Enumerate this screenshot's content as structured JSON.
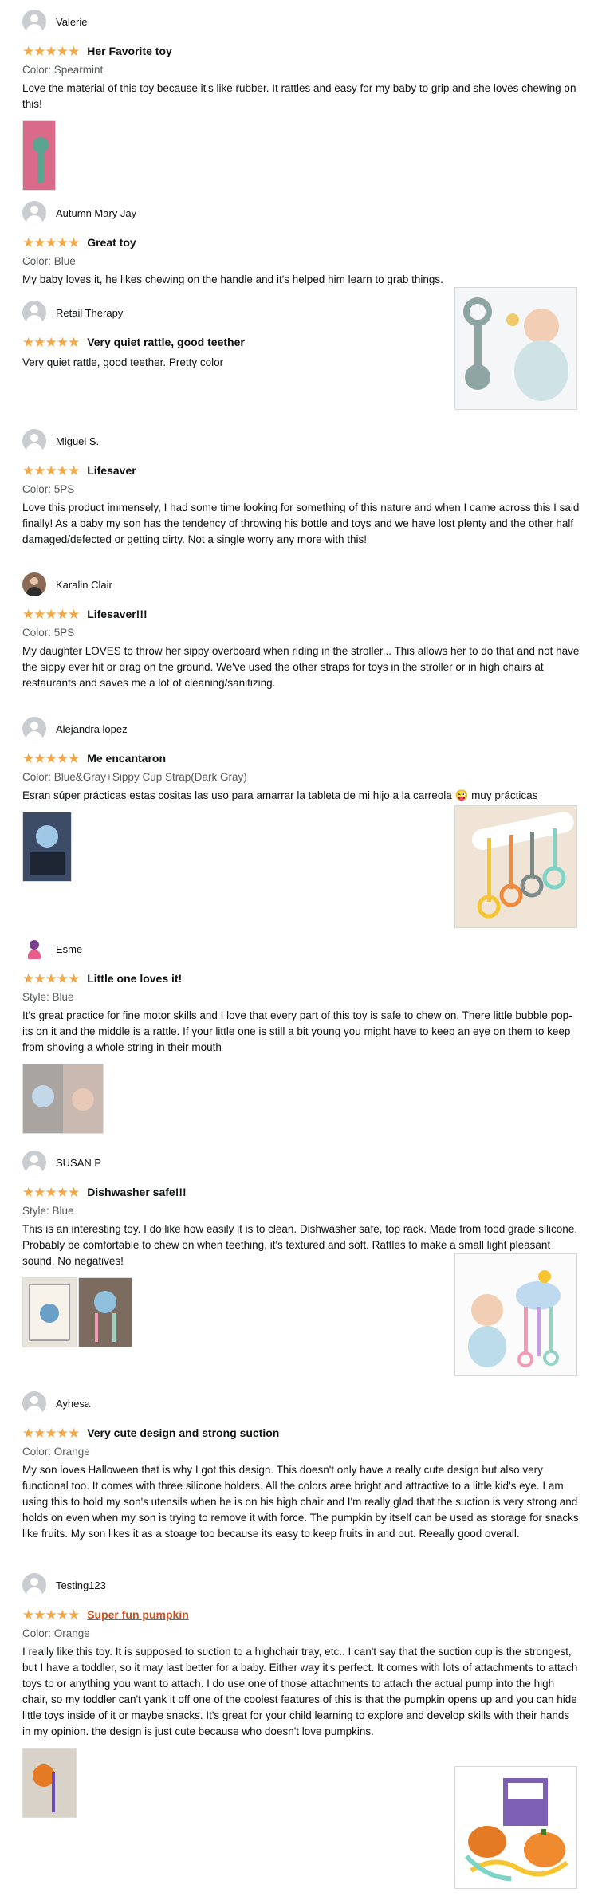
{
  "reviews": [
    {
      "name": "Valerie",
      "stars": "★★★★★",
      "title": "Her Favorite toy",
      "variant": "Color: Spearmint",
      "body": "Love the material of this toy because it's like rubber. It rattles and easy for my baby to grip and she loves chewing on this!"
    },
    {
      "name": "Autumn Mary Jay",
      "stars": "★★★★★",
      "title": "Great toy",
      "variant": "Color: Blue",
      "body": "My baby loves it, he likes chewing on the handle and it's helped him learn to grab things."
    },
    {
      "name": "Retail Therapy",
      "stars": "★★★★★",
      "title": "Very quiet rattle, good teether",
      "variant": "",
      "body": "Very quiet rattle, good teether. Pretty color"
    },
    {
      "name": "Miguel S.",
      "stars": "★★★★★",
      "title": "Lifesaver",
      "variant": "Color: 5PS",
      "body": "Love this product immensely, I had some time looking for something of this nature and when I came across this I said finally! As a baby my son has the tendency of throwing his bottle and toys and we have lost plenty and the other half damaged/defected or getting dirty. Not a single worry any more with this!"
    },
    {
      "name": "Karalin Clair",
      "stars": "★★★★★",
      "title": "Lifesaver!!!",
      "variant": "Color: 5PS",
      "body": "My daughter LOVES to throw her sippy overboard when riding in the stroller... This allows her to do that and not have the sippy ever hit or drag on the ground. We've used the other straps for toys in the stroller or in high chairs at restaurants and saves me a lot of cleaning/sanitizing."
    },
    {
      "name": "Alejandra lopez",
      "stars": "★★★★★",
      "title": "Me encantaron",
      "variant": "Color: Blue&Gray+Sippy Cup Strap(Dark Gray)",
      "body": "Esran súper prácticas estas cositas las uso para amarrar la tableta de mi hijo a la carreola 😜 muy prácticas"
    },
    {
      "name": "Esme",
      "stars": "★★★★★",
      "title": "Little one loves it!",
      "variant": "Style: Blue",
      "body": "It's great practice for fine motor skills and I love that every part of this toy is safe to chew on. There little bubble pop-its on it and the middle is a rattle. If your little one is still a bit young you might have to keep an eye on them to keep from shoving a whole string in their mouth"
    },
    {
      "name": "SUSAN P",
      "stars": "★★★★★",
      "title": "Dishwasher safe!!!",
      "variant": "Style: Blue",
      "body": "This is an interesting toy. I do like how easily it is to clean. Dishwasher safe, top rack. Made from food grade silicone. Probably be comfortable to chew on when teething, it's textured and soft. Rattles to make a small light pleasant sound. No negatives!"
    },
    {
      "name": "Ayhesa",
      "stars": "★★★★★",
      "title": "Very cute design and strong suction",
      "variant": "Color: Orange",
      "body": "My son loves Halloween that is why I got this design. This doesn't only have a really cute design but also very functional too. It comes with three silicone holders. All the colors aree bright and attractive to a little kid's eye. I am using this to hold my son's utensils when he is on his high chair and I'm really glad that the suction is very strong and holds on even when my son is trying to remove it with force. The pumpkin by itself can be used as storage for snacks like fruits. My son likes it as a stoage too because its easy to keep fruits in and out. Reeally good overall."
    },
    {
      "name": "Testing123",
      "stars": "★★★★★",
      "title": "Super fun pumpkin",
      "variant": "Color: Orange",
      "body": "I really like this toy. It is supposed to suction to a highchair tray, etc.. I can't say that the suction cup is the strongest, but I have a toddler, so it may last better for a baby. Either way it's perfect. It comes with lots of attachments to attach toys to or anything you want to attach. I do use one of those attachments to attach the actual pump into the high chair, so my toddler can't yank it off one of the coolest features of this is that the pumpkin opens up and you can hide little toys inside of it or maybe snacks. It's great for your child learning to explore and develop skills with their hands in my opinion. the design is just cute because who doesn't love pumpkins."
    }
  ],
  "colors": {
    "star": "#f3a847",
    "link": "#c7511f",
    "muted": "#565959"
  }
}
